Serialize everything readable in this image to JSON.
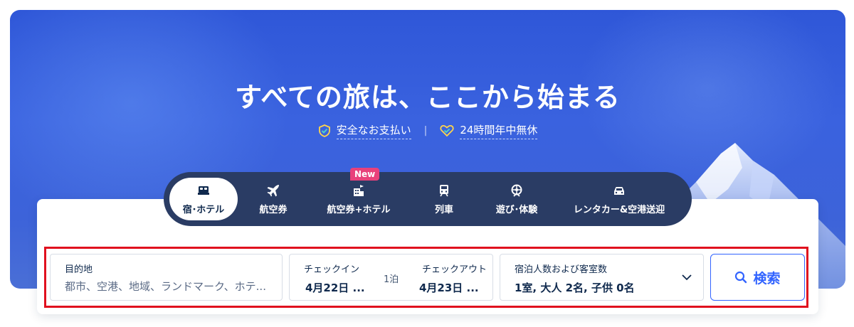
{
  "hero": {
    "title": "すべての旅は、ここから始まる",
    "badges": [
      {
        "icon": "shield-check-icon",
        "label": "安全なお支払い"
      },
      {
        "icon": "heart-check-icon",
        "label": "24時間年中無休"
      }
    ],
    "separator": "|"
  },
  "tabs": [
    {
      "icon": "bed-icon",
      "label": "宿･ホテル",
      "active": true
    },
    {
      "icon": "plane-icon",
      "label": "航空券",
      "active": false
    },
    {
      "icon": "flight-hotel-icon",
      "label": "航空券+ホテル",
      "active": false,
      "badge": "New"
    },
    {
      "icon": "train-icon",
      "label": "列車",
      "active": false
    },
    {
      "icon": "attraction-icon",
      "label": "遊び･体験",
      "active": false
    },
    {
      "icon": "car-icon",
      "label": "レンタカー&空港送迎",
      "active": false
    }
  ],
  "search": {
    "destination": {
      "label": "目的地",
      "placeholder": "都市、空港、地域、ランドマーク、ホテ..."
    },
    "checkin": {
      "label": "チェックイン",
      "value": "4月22日 ..."
    },
    "nights": "1泊",
    "checkout": {
      "label": "チェックアウト",
      "value": "4月23日 ..."
    },
    "guests": {
      "label": "宿泊人数および客室数",
      "value": "1室, 大人 2名, 子供 0名"
    },
    "button_label": "検索"
  },
  "colors": {
    "accent": "#3264ff",
    "tabbar": "#2a3c64",
    "new_badge": "#e8417b",
    "highlight": "#e0101e"
  }
}
